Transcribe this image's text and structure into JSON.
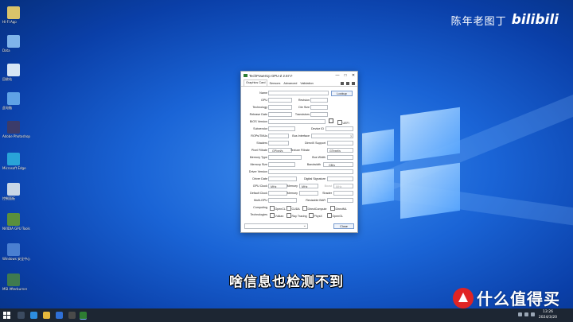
{
  "watermark": {
    "author": "陈年老图丁",
    "logo": "bilibili"
  },
  "desktop_icons": [
    {
      "label": "Hi-Fi App",
      "color": "#d9c36a"
    },
    {
      "label": "Data",
      "color": "#7fb4ea"
    },
    {
      "label": "回收站",
      "color": "#d7e6f5"
    },
    {
      "label": "此电脑",
      "color": "#5fa2e6"
    },
    {
      "label": "Adobe Photoshop",
      "color": "#3b3b6a"
    },
    {
      "label": "Microsoft Edge",
      "color": "#29a3d8"
    },
    {
      "label": "控制面板",
      "color": "#c8d6e6"
    },
    {
      "label": "NVIDIA GPU Tools",
      "color": "#5a8f3d"
    },
    {
      "label": "Windows 安全中心",
      "color": "#4a7fd1"
    },
    {
      "label": "MSI Afterburner",
      "color": "#3f7a4f"
    }
  ],
  "gpuz": {
    "title": "TechPowerUp GPU-Z 2.57.0",
    "tabs": [
      "Graphics Card",
      "Sensors",
      "Advanced",
      "Validation"
    ],
    "labels": {
      "name": "Name",
      "gpu": "GPU",
      "revision": "Revision",
      "technology": "Technology",
      "die_size": "Die Size",
      "release_date": "Release Date",
      "transistors": "Transistors",
      "bios_version": "BIOS Version",
      "subvendor": "Subvendor",
      "device_id": "Device ID",
      "rops": "ROPs/TMUs",
      "bus_interface": "Bus Interface",
      "shaders": "Shaders",
      "directx": "DirectX Support",
      "pixel_fillrate": "Pixel Fillrate",
      "texture_fillrate": "Texture Fillrate",
      "memory_type": "Memory Type",
      "bus_width": "Bus Width",
      "memory_size": "Memory Size",
      "bandwidth": "Bandwidth",
      "driver_version": "Driver Version",
      "driver_date": "Driver Date",
      "digital_signature": "Digital Signature",
      "gpu_clock": "GPU Clock",
      "memory": "Memory",
      "boost": "Boost",
      "default_clock": "Default Clock",
      "shader": "Shader",
      "multi_gpu": "Multi-GPU",
      "resizable_bar": "Resizable BAR",
      "computing": "Computing",
      "technologies": "Technologies"
    },
    "units": {
      "gpixel": "GPixel/s",
      "gtexel": "GTexel/s",
      "gbs": "GB/s",
      "mhz": "MHz"
    },
    "uefi": "UEFI",
    "lookup": "Lookup",
    "bus_q": "?",
    "computing": [
      "OpenCL",
      "CUDA",
      "DirectCompute",
      "DirectML"
    ],
    "technologies": [
      "Vulkan",
      "Ray Tracing",
      "PhysX",
      "OpenGL"
    ],
    "close": "Close",
    "window_buttons": [
      "—",
      "□",
      "✕"
    ]
  },
  "subtitle": "啥信息也检测不到",
  "brand": {
    "name": "什么值得买"
  },
  "tray": {
    "time": "13:26",
    "date": "2024/3/20"
  }
}
